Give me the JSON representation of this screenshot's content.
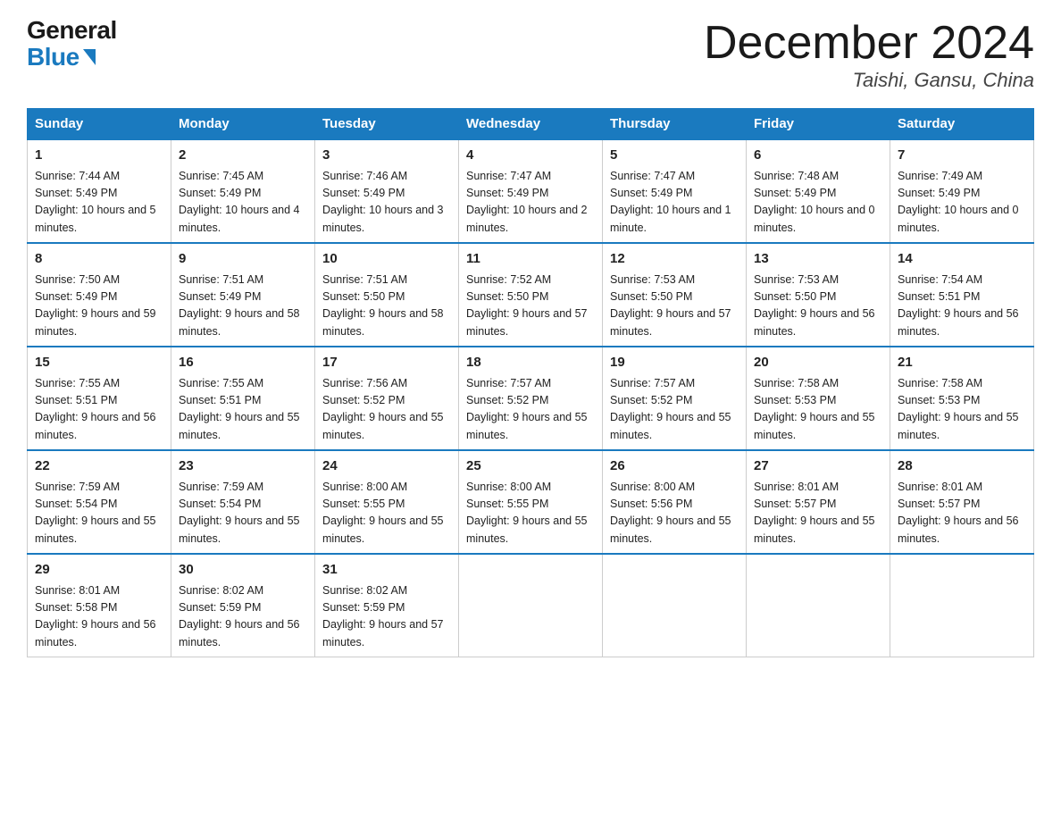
{
  "logo": {
    "general": "General",
    "blue": "Blue"
  },
  "title": "December 2024",
  "location": "Taishi, Gansu, China",
  "days_header": [
    "Sunday",
    "Monday",
    "Tuesday",
    "Wednesday",
    "Thursday",
    "Friday",
    "Saturday"
  ],
  "weeks": [
    [
      {
        "num": "1",
        "sunrise": "7:44 AM",
        "sunset": "5:49 PM",
        "daylight": "10 hours and 5 minutes."
      },
      {
        "num": "2",
        "sunrise": "7:45 AM",
        "sunset": "5:49 PM",
        "daylight": "10 hours and 4 minutes."
      },
      {
        "num": "3",
        "sunrise": "7:46 AM",
        "sunset": "5:49 PM",
        "daylight": "10 hours and 3 minutes."
      },
      {
        "num": "4",
        "sunrise": "7:47 AM",
        "sunset": "5:49 PM",
        "daylight": "10 hours and 2 minutes."
      },
      {
        "num": "5",
        "sunrise": "7:47 AM",
        "sunset": "5:49 PM",
        "daylight": "10 hours and 1 minute."
      },
      {
        "num": "6",
        "sunrise": "7:48 AM",
        "sunset": "5:49 PM",
        "daylight": "10 hours and 0 minutes."
      },
      {
        "num": "7",
        "sunrise": "7:49 AM",
        "sunset": "5:49 PM",
        "daylight": "10 hours and 0 minutes."
      }
    ],
    [
      {
        "num": "8",
        "sunrise": "7:50 AM",
        "sunset": "5:49 PM",
        "daylight": "9 hours and 59 minutes."
      },
      {
        "num": "9",
        "sunrise": "7:51 AM",
        "sunset": "5:49 PM",
        "daylight": "9 hours and 58 minutes."
      },
      {
        "num": "10",
        "sunrise": "7:51 AM",
        "sunset": "5:50 PM",
        "daylight": "9 hours and 58 minutes."
      },
      {
        "num": "11",
        "sunrise": "7:52 AM",
        "sunset": "5:50 PM",
        "daylight": "9 hours and 57 minutes."
      },
      {
        "num": "12",
        "sunrise": "7:53 AM",
        "sunset": "5:50 PM",
        "daylight": "9 hours and 57 minutes."
      },
      {
        "num": "13",
        "sunrise": "7:53 AM",
        "sunset": "5:50 PM",
        "daylight": "9 hours and 56 minutes."
      },
      {
        "num": "14",
        "sunrise": "7:54 AM",
        "sunset": "5:51 PM",
        "daylight": "9 hours and 56 minutes."
      }
    ],
    [
      {
        "num": "15",
        "sunrise": "7:55 AM",
        "sunset": "5:51 PM",
        "daylight": "9 hours and 56 minutes."
      },
      {
        "num": "16",
        "sunrise": "7:55 AM",
        "sunset": "5:51 PM",
        "daylight": "9 hours and 55 minutes."
      },
      {
        "num": "17",
        "sunrise": "7:56 AM",
        "sunset": "5:52 PM",
        "daylight": "9 hours and 55 minutes."
      },
      {
        "num": "18",
        "sunrise": "7:57 AM",
        "sunset": "5:52 PM",
        "daylight": "9 hours and 55 minutes."
      },
      {
        "num": "19",
        "sunrise": "7:57 AM",
        "sunset": "5:52 PM",
        "daylight": "9 hours and 55 minutes."
      },
      {
        "num": "20",
        "sunrise": "7:58 AM",
        "sunset": "5:53 PM",
        "daylight": "9 hours and 55 minutes."
      },
      {
        "num": "21",
        "sunrise": "7:58 AM",
        "sunset": "5:53 PM",
        "daylight": "9 hours and 55 minutes."
      }
    ],
    [
      {
        "num": "22",
        "sunrise": "7:59 AM",
        "sunset": "5:54 PM",
        "daylight": "9 hours and 55 minutes."
      },
      {
        "num": "23",
        "sunrise": "7:59 AM",
        "sunset": "5:54 PM",
        "daylight": "9 hours and 55 minutes."
      },
      {
        "num": "24",
        "sunrise": "8:00 AM",
        "sunset": "5:55 PM",
        "daylight": "9 hours and 55 minutes."
      },
      {
        "num": "25",
        "sunrise": "8:00 AM",
        "sunset": "5:55 PM",
        "daylight": "9 hours and 55 minutes."
      },
      {
        "num": "26",
        "sunrise": "8:00 AM",
        "sunset": "5:56 PM",
        "daylight": "9 hours and 55 minutes."
      },
      {
        "num": "27",
        "sunrise": "8:01 AM",
        "sunset": "5:57 PM",
        "daylight": "9 hours and 55 minutes."
      },
      {
        "num": "28",
        "sunrise": "8:01 AM",
        "sunset": "5:57 PM",
        "daylight": "9 hours and 56 minutes."
      }
    ],
    [
      {
        "num": "29",
        "sunrise": "8:01 AM",
        "sunset": "5:58 PM",
        "daylight": "9 hours and 56 minutes."
      },
      {
        "num": "30",
        "sunrise": "8:02 AM",
        "sunset": "5:59 PM",
        "daylight": "9 hours and 56 minutes."
      },
      {
        "num": "31",
        "sunrise": "8:02 AM",
        "sunset": "5:59 PM",
        "daylight": "9 hours and 57 minutes."
      },
      null,
      null,
      null,
      null
    ]
  ]
}
